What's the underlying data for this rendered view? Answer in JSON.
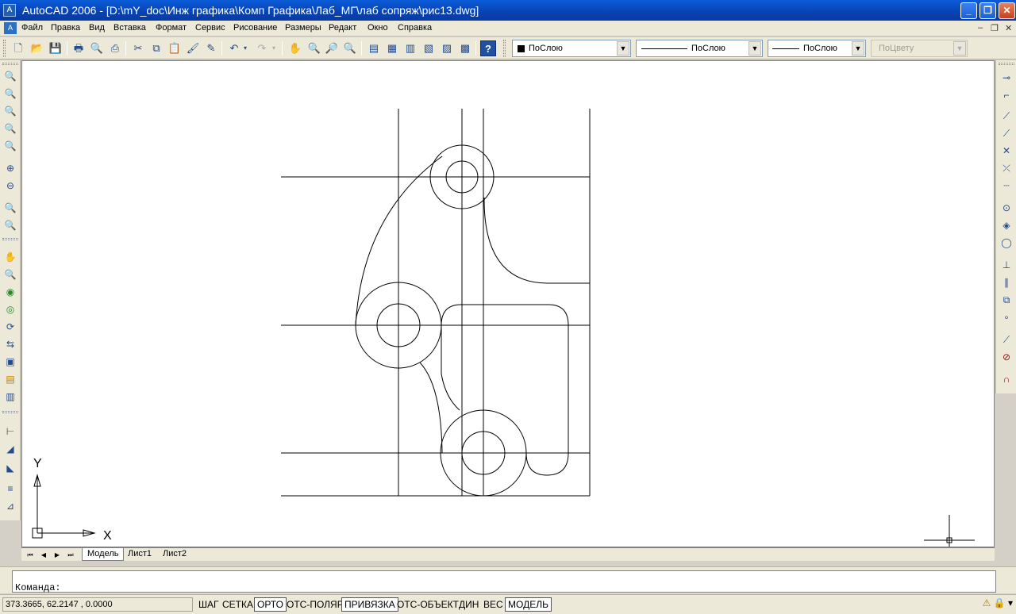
{
  "window": {
    "title": "AutoCAD 2006 - [D:\\mY_doc\\Инж графика\\Комп Графика\\Лаб_МГ\\лаб сопряж\\рис13.dwg]"
  },
  "menu": [
    "Файл",
    "Правка",
    "Вид",
    "Вставка",
    "Формат",
    "Сервис",
    "Рисование",
    "Размеры",
    "Редакт",
    "Окно",
    "Справка"
  ],
  "properties": {
    "color": "ПоСлою",
    "linetype": "ПоСлою",
    "lineweight": "ПоСлою",
    "plotstyle": "ПоЦвету"
  },
  "ucs": {
    "x": "X",
    "y": "Y"
  },
  "tabs": [
    "Модель",
    "Лист1",
    "Лист2"
  ],
  "command": {
    "prompt": "Команда:"
  },
  "status": {
    "coords": "373.3665, 62.2147 , 0.0000",
    "buttons": [
      "ШАГ",
      "СЕТКА",
      "ОРТО",
      "ОТС-ПОЛЯР",
      "ПРИВЯЗКА",
      "ОТС-ОБЪЕКТ",
      "ДИН",
      "ВЕС",
      "МОДЕЛЬ"
    ]
  }
}
